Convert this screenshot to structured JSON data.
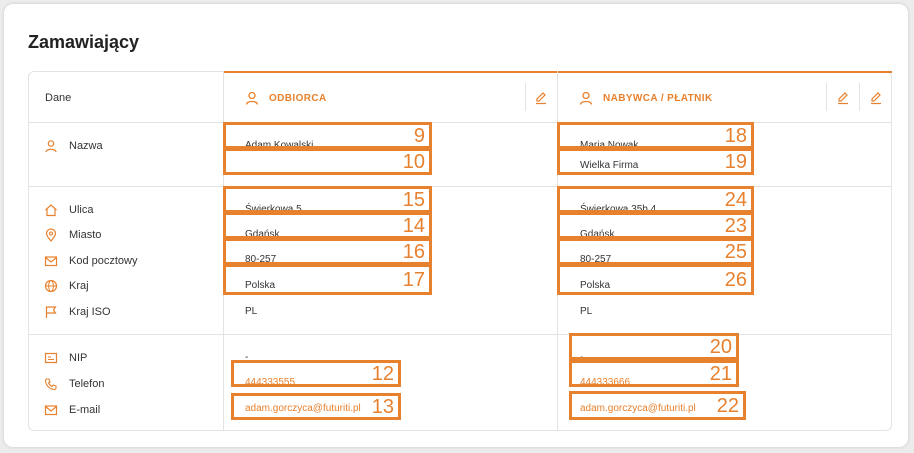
{
  "title": "Zamawiający",
  "header": {
    "dane_label": "Dane",
    "odbiorca_title": "ODBIORCA",
    "nabywca_title": "NABYWCA / PŁATNIK"
  },
  "labels": {
    "nazwa": "Nazwa",
    "ulica": "Ulica",
    "miasto": "Miasto",
    "kod": "Kod pocztowy",
    "kraj": "Kraj",
    "kraj_iso": "Kraj ISO",
    "nip": "NIP",
    "telefon": "Telefon",
    "email": "E-mail"
  },
  "odbiorca": {
    "nazwa1": "Adam Kowalski",
    "nazwa2": "",
    "ulica": "Świerkowa 5",
    "miasto": "Gdańsk",
    "kod": "80-257",
    "kraj": "Polska",
    "kraj_iso": "PL",
    "nip": "-",
    "telefon": "444333555",
    "email": "adam.gorczyca@futuriti.pl"
  },
  "nabywca": {
    "nazwa1": "Maria Nowak",
    "nazwa2": "Wielka Firma",
    "ulica": "Świerkowa 35b 4",
    "miasto": "Gdańsk",
    "kod": "80-257",
    "kraj": "Polska",
    "kraj_iso": "PL",
    "nip": "-",
    "telefon": "444333666",
    "email": "adam.gorczyca@futuriti.pl"
  },
  "annotations": {
    "n9": "9",
    "n10": "10",
    "n15": "15",
    "n14": "14",
    "n16": "16",
    "n17": "17",
    "n12": "12",
    "n13": "13",
    "n18": "18",
    "n19": "19",
    "n24": "24",
    "n23": "23",
    "n25": "25",
    "n26": "26",
    "n20": "20",
    "n21": "21",
    "n22": "22"
  },
  "colors": {
    "accent": "#e8812e",
    "border": "#e3e3e3"
  },
  "icons": {
    "user": "user-icon",
    "home": "home-icon",
    "pin": "map-pin-icon",
    "mail": "mail-icon",
    "globe": "globe-icon",
    "flag": "flag-icon",
    "id": "id-card-icon",
    "phone": "phone-icon",
    "edit": "pencil-icon"
  }
}
